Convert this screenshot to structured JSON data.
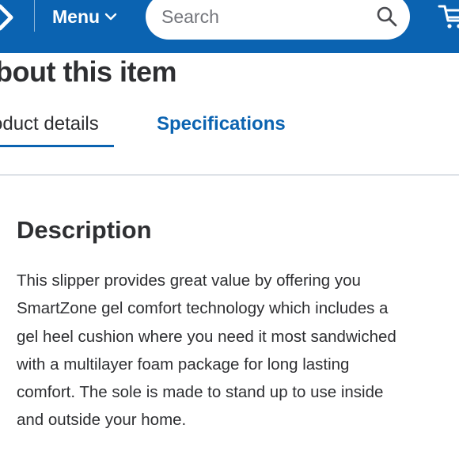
{
  "header": {
    "menu_label": "Menu",
    "search_placeholder": "Search",
    "icons": {
      "logo": "chevron-right-icon",
      "menu": "chevron-down-icon",
      "search": "search-icon",
      "cart": "cart-icon"
    },
    "colors": {
      "brand_blue": "#0b63b1",
      "text": "#2e2f32"
    }
  },
  "page": {
    "title": "bout this item"
  },
  "tabs": [
    {
      "label": "oduct details",
      "active": true
    },
    {
      "label": "Specifications",
      "active": false
    }
  ],
  "description": {
    "heading": "Description",
    "lines": [
      "This slipper provides great value by offering you",
      "SmartZone gel comfort technology which includes a",
      "gel heel cushion where you need it most sandwiched",
      "with a multilayer foam package for long lasting",
      "comfort. The sole is made to stand up to use inside",
      "and outside your home."
    ]
  }
}
